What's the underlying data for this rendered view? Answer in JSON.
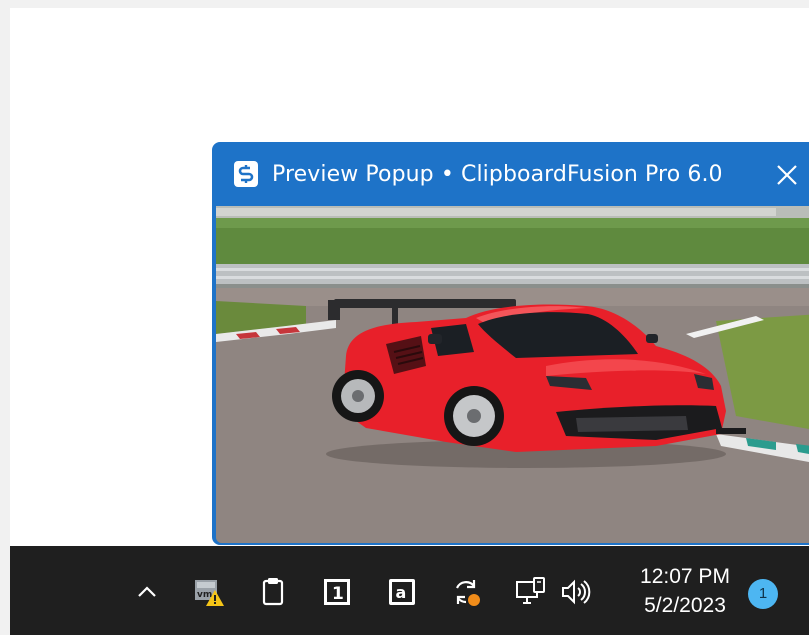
{
  "popup": {
    "title": "Preview Popup • ClipboardFusion Pro 6.0",
    "app_icon": "clipboardfusion-icon",
    "close_icon": "close-icon",
    "preview_image": "red sports car on race track"
  },
  "taskbar": {
    "tray_icons": [
      "chevron-up-icon",
      "vmware-warning-icon",
      "clipboard-icon",
      "virtual-desktop-1-icon",
      "amazon-icon",
      "sync-alert-icon",
      "network-icon",
      "volume-icon"
    ],
    "clock": {
      "time": "12:07 PM",
      "date": "5/2/2023"
    },
    "notification_count": "1"
  },
  "colors": {
    "titlebar": "#1e73c8",
    "taskbar": "#1f1f1f",
    "badge": "#4db6f2",
    "car": "#e8202a"
  }
}
